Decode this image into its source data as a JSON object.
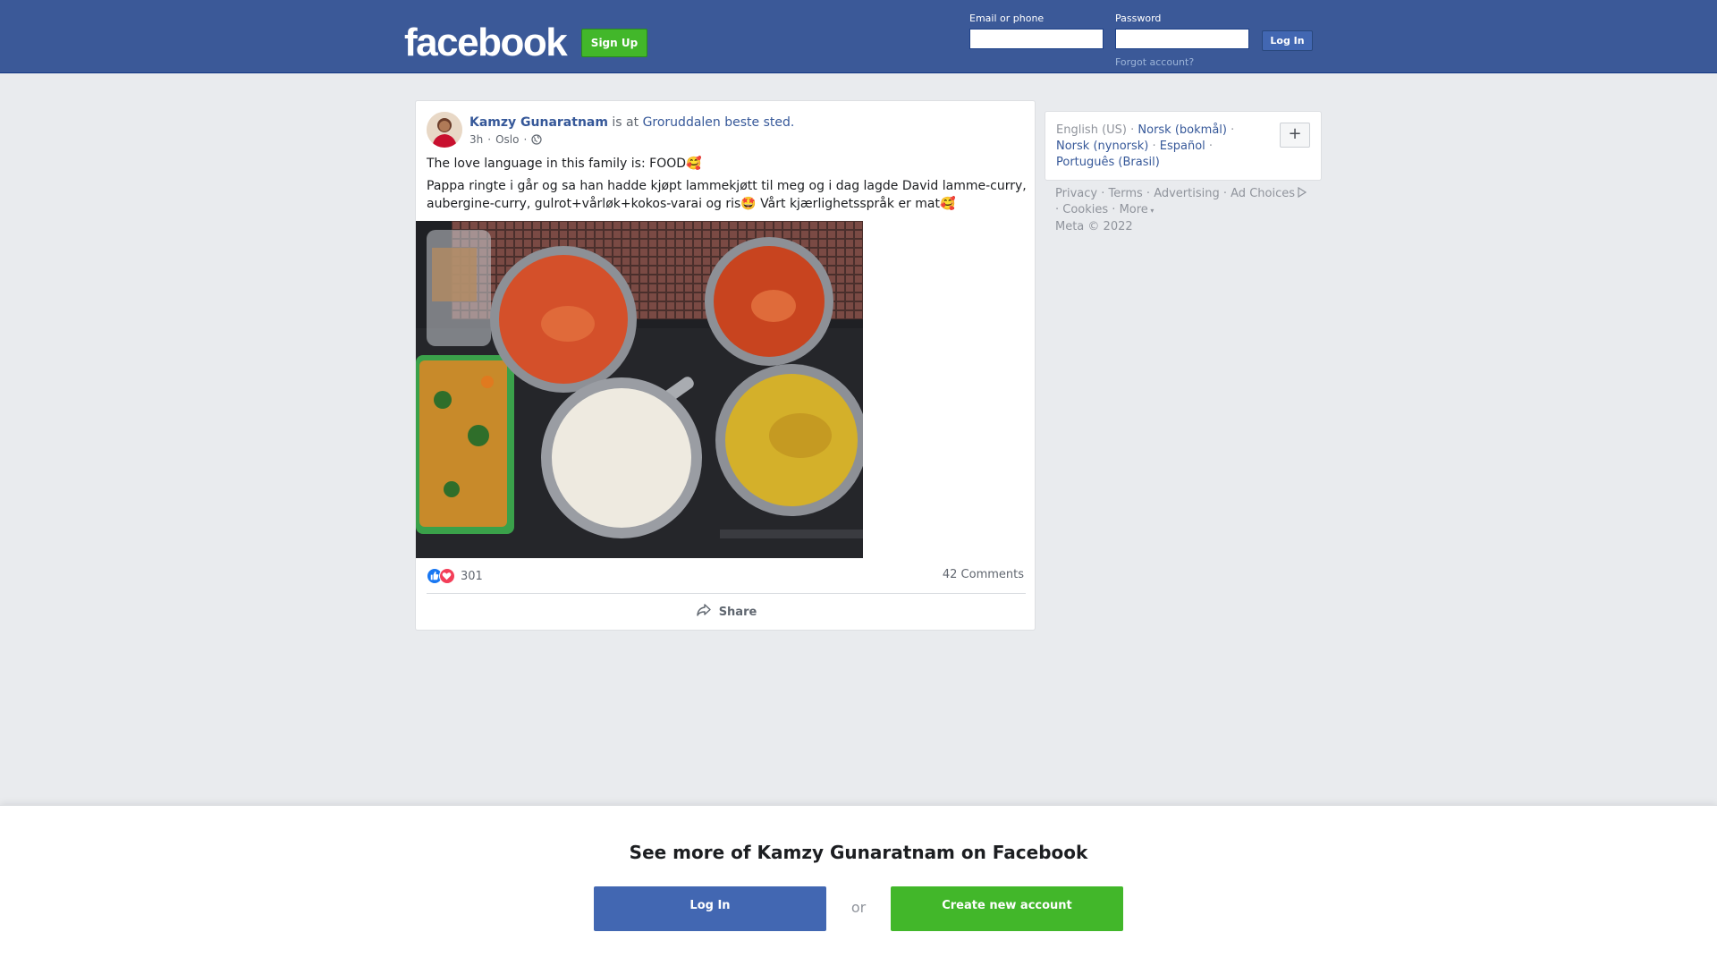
{
  "header": {
    "logo_text": "facebook",
    "signup_label": "Sign Up",
    "email_label": "Email or phone",
    "email_value": "",
    "password_label": "Password",
    "password_value": "",
    "login_label": "Log In",
    "forgot_label": "Forgot account?"
  },
  "post": {
    "author": "Kamzy Gunaratnam",
    "is_at": "is at",
    "place": "Groruddalen beste sted.",
    "time": "3h",
    "location": "Oslo",
    "separator": "·",
    "audience_icon": "globe-icon",
    "text_line1": "The love language in this family is: FOOD🥰",
    "text_line2": "Pappa ringte i går og sa han hadde kjøpt lammekjøtt til meg og i dag lagde David lamme-curry, aubergine-curry, gulrot+vårløk+kokos-varai og ris🤩 Vårt kjærlighetsspråk er mat🥰",
    "reaction_count": "301",
    "comments": "42 Comments",
    "share_label": "Share"
  },
  "languages": {
    "current": "English (US)",
    "items": [
      "Norsk (bokmål)",
      "Norsk (nynorsk)",
      "Español",
      "Português (Brasil)"
    ],
    "plus": "+"
  },
  "footer": {
    "links": [
      "Privacy",
      "Terms",
      "Advertising",
      "Ad Choices",
      "Cookies",
      "More"
    ],
    "copyright": "Meta © 2022"
  },
  "banner": {
    "title": "See more of Kamzy Gunaratnam on Facebook",
    "login_label": "Log In",
    "or_label": "or",
    "create_label": "Create new account"
  },
  "colors": {
    "brand_blue": "#3b5998",
    "button_blue": "#4267b2",
    "signup_green": "#42b72a",
    "link_blue": "#365899"
  }
}
